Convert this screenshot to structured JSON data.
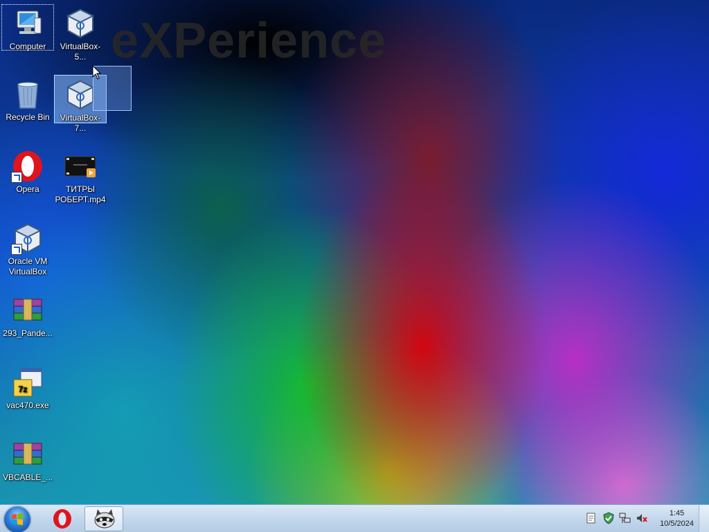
{
  "wallpaper": {
    "watermark": "eXPerience"
  },
  "desktop": {
    "icons": [
      {
        "label": "Computer",
        "icon": "computer-icon"
      },
      {
        "label": "VirtualBox-5...",
        "icon": "virtualbox-icon"
      },
      {
        "label": "Recycle Bin",
        "icon": "recycle-bin-icon"
      },
      {
        "label": "VirtualBox-7...",
        "icon": "virtualbox-icon"
      },
      {
        "label": "Opera",
        "icon": "opera-icon"
      },
      {
        "label": "ТИТРЫ РОБЕРТ.mp4",
        "icon": "video-file-icon"
      },
      {
        "label": "Oracle VM VirtualBox",
        "icon": "virtualbox-icon"
      },
      {
        "label": "293_Pande...",
        "icon": "winrar-archive-icon"
      },
      {
        "label": "vac470.exe",
        "icon": "7zip-installer-icon"
      },
      {
        "label": "VBCABLE_...",
        "icon": "winrar-archive-icon"
      }
    ]
  },
  "taskbar": {
    "start_icon": "windows-start-icon",
    "pinned": [
      {
        "name": "opera-taskbar-icon"
      },
      {
        "name": "raccoon-app-icon"
      }
    ],
    "tray": [
      "action-center-icon",
      "security-shield-icon",
      "network-icon",
      "volume-muted-icon"
    ],
    "clock": {
      "time": "1:45",
      "date": "10/5/2024"
    }
  },
  "colors": {
    "accent": "#2d7dd8",
    "taskbar": "#c3d7ec",
    "selection": "#8cbefa"
  }
}
